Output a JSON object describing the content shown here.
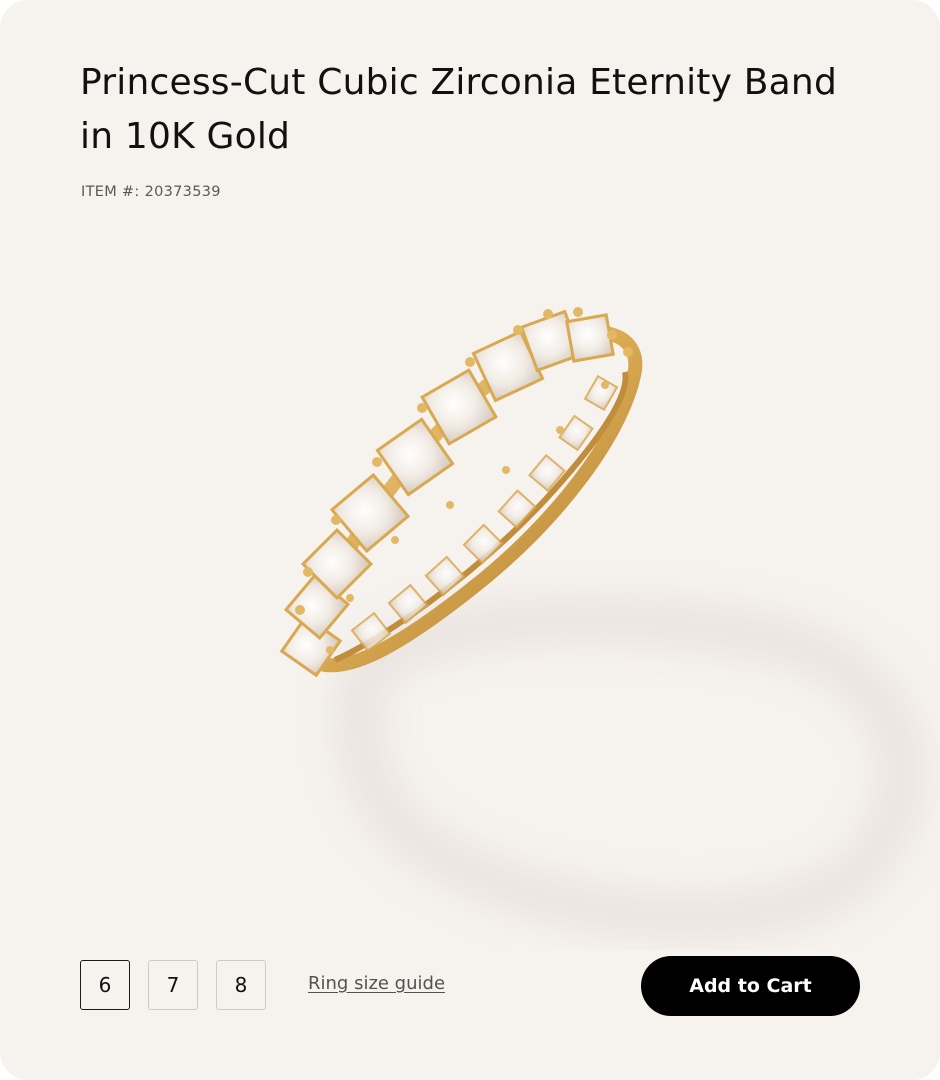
{
  "product": {
    "title": "Princess-Cut Cubic Zirconia Eternity Band in 10K Gold",
    "item_label": "ITEM #:",
    "item_number": "20373539",
    "image": "gold-princess-cut-eternity-ring"
  },
  "sizes": {
    "options": [
      "6",
      "7",
      "8"
    ],
    "selected": "6",
    "guide_label": "Ring size guide"
  },
  "actions": {
    "add_to_cart_label": "Add to Cart"
  },
  "colors": {
    "background": "#f6f2ee",
    "text": "#111111",
    "muted": "#5b5856",
    "button": "#000000",
    "gold": "#d9a952"
  }
}
